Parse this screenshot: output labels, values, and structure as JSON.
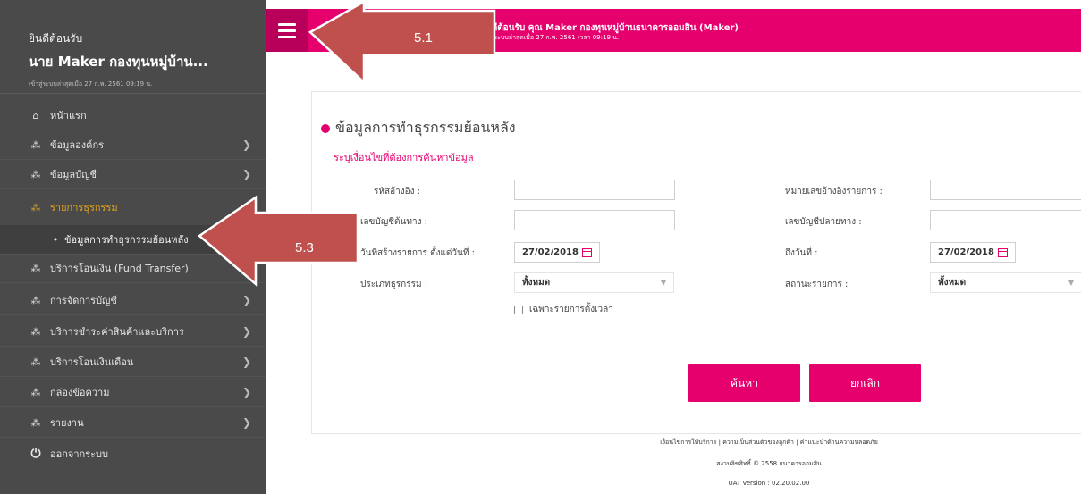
{
  "sidebar": {
    "welcome": "ยินดีต้อนรับ",
    "username": "นาย Maker กองทุนหมู่บ้าน...",
    "last_login": "เข้าสู่ระบบล่าสุดเมื่อ 27 ก.พ. 2561 09:19 น.",
    "items": [
      {
        "label": "หน้าแรก",
        "icon": "home-icon",
        "has_chevron": false
      },
      {
        "label": "ข้อมูลองค์กร",
        "icon": "org-icon",
        "has_chevron": true
      },
      {
        "label": "ข้อมูลบัญชี",
        "icon": "org-icon",
        "has_chevron": true
      },
      {
        "label": "รายการธุรกรรม",
        "icon": "org-icon",
        "has_chevron": false,
        "active": true
      },
      {
        "label": "ข้อมูลการทำธุรกรรมย้อนหลัง",
        "icon": "bullet-icon",
        "sub": true
      },
      {
        "label": "บริการโอนเงิน (Fund Transfer)",
        "icon": "org-icon",
        "has_chevron": false
      },
      {
        "label": "การจัดการบัญชี",
        "icon": "org-icon",
        "has_chevron": true
      },
      {
        "label": "บริการชำระค่าสินค้าและบริการ",
        "icon": "org-icon",
        "has_chevron": true
      },
      {
        "label": "บริการโอนเงินเดือน",
        "icon": "org-icon",
        "has_chevron": true
      },
      {
        "label": "กล่องข้อความ",
        "icon": "org-icon",
        "has_chevron": true
      },
      {
        "label": "รายงาน",
        "icon": "org-icon",
        "has_chevron": true
      },
      {
        "label": "ออกจากระบบ",
        "icon": "power-icon",
        "has_chevron": false
      }
    ]
  },
  "header": {
    "title": "ยินดีต้อนรับ คุณ Maker กองทุนหมู่บ้านธนาคารออมสิน (Maker)",
    "subtitle": "เข้าสู่ระบบล่าสุดเมื่อ 27 ก.พ. 2561 เวลา 09:19 น."
  },
  "form": {
    "section_title": "ข้อมูลการทำธุรกรรมย้อนหลัง",
    "section_subtitle": "ระบุเงื่อนไขที่ต้องการค้นหาข้อมูล",
    "ref_code_label": "รหัสอ้างอิง :",
    "ref_code_value": "",
    "txn_ref_label": "หมายเลขอ้างอิงรายการ :",
    "txn_ref_value": "",
    "src_acct_label": "เลขบัญชีต้นทาง :",
    "src_acct_value": "",
    "dst_acct_label": "เลขบัญชีปลายทาง :",
    "dst_acct_value": "",
    "from_date_label": "วันที่สร้างรายการ ตั้งแต่วันที่ :",
    "from_date_value": "27/02/2018",
    "to_date_label": "ถึงวันที่ :",
    "to_date_value": "27/02/2018",
    "txn_type_label": "ประเภทธุรกรรม :",
    "txn_type_value": "ทั้งหมด",
    "status_label": "สถานะรายการ :",
    "status_value": "ทั้งหมด",
    "scheduled_only_label": "เฉพาะรายการตั้งเวลา",
    "scheduled_only_checked": false,
    "search_button": "ค้นหา",
    "cancel_button": "ยกเลิก"
  },
  "footer": {
    "links": "เงื่อนไขการให้บริการ | ความเป็นส่วนตัวของลูกค้า | คำแนะนำด้านความปลอดภัย",
    "copyright": "สงวนลิขสิทธิ์ © 2558 ธนาคารออมสิน",
    "version": "UAT Version : 02.20.02.00"
  },
  "annotations": {
    "callout_1": "5.1",
    "callout_2": "5.3"
  },
  "colors": {
    "brand_pink": "#e6006e",
    "sidebar_bg": "#4a4a4a",
    "active_item": "#e2a51a",
    "callout_red": "#c0504d"
  }
}
